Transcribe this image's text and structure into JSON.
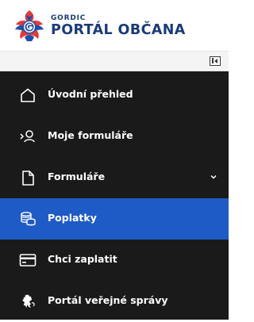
{
  "header": {
    "brand_small": "GORDIC",
    "brand_big": "PORTÁL OBČANA",
    "logo_icon": "gordic-logo-icon"
  },
  "collapse_bar": {
    "toggle_icon": "collapse-sidebar-icon"
  },
  "nav": {
    "items": [
      {
        "label": "Úvodní přehled",
        "icon": "home-icon",
        "active": false
      },
      {
        "label": "Moje formuláře",
        "icon": "user-search-icon",
        "active": false
      },
      {
        "label": "Formuláře",
        "icon": "document-icon",
        "active": false,
        "has_submenu": true
      },
      {
        "label": "Poplatky",
        "icon": "coins-icon",
        "active": true
      },
      {
        "label": "Chci zaplatit",
        "icon": "credit-card-icon",
        "active": false
      },
      {
        "label": "Portál veřejné správy",
        "icon": "czech-lion-icon",
        "active": false
      }
    ]
  },
  "colors": {
    "brand_blue": "#1b3a78",
    "sidebar_bg": "#1a1a1a",
    "active_bg": "#1f5bc6",
    "logo_red": "#e23b3b",
    "logo_blue": "#1f4fa8"
  }
}
